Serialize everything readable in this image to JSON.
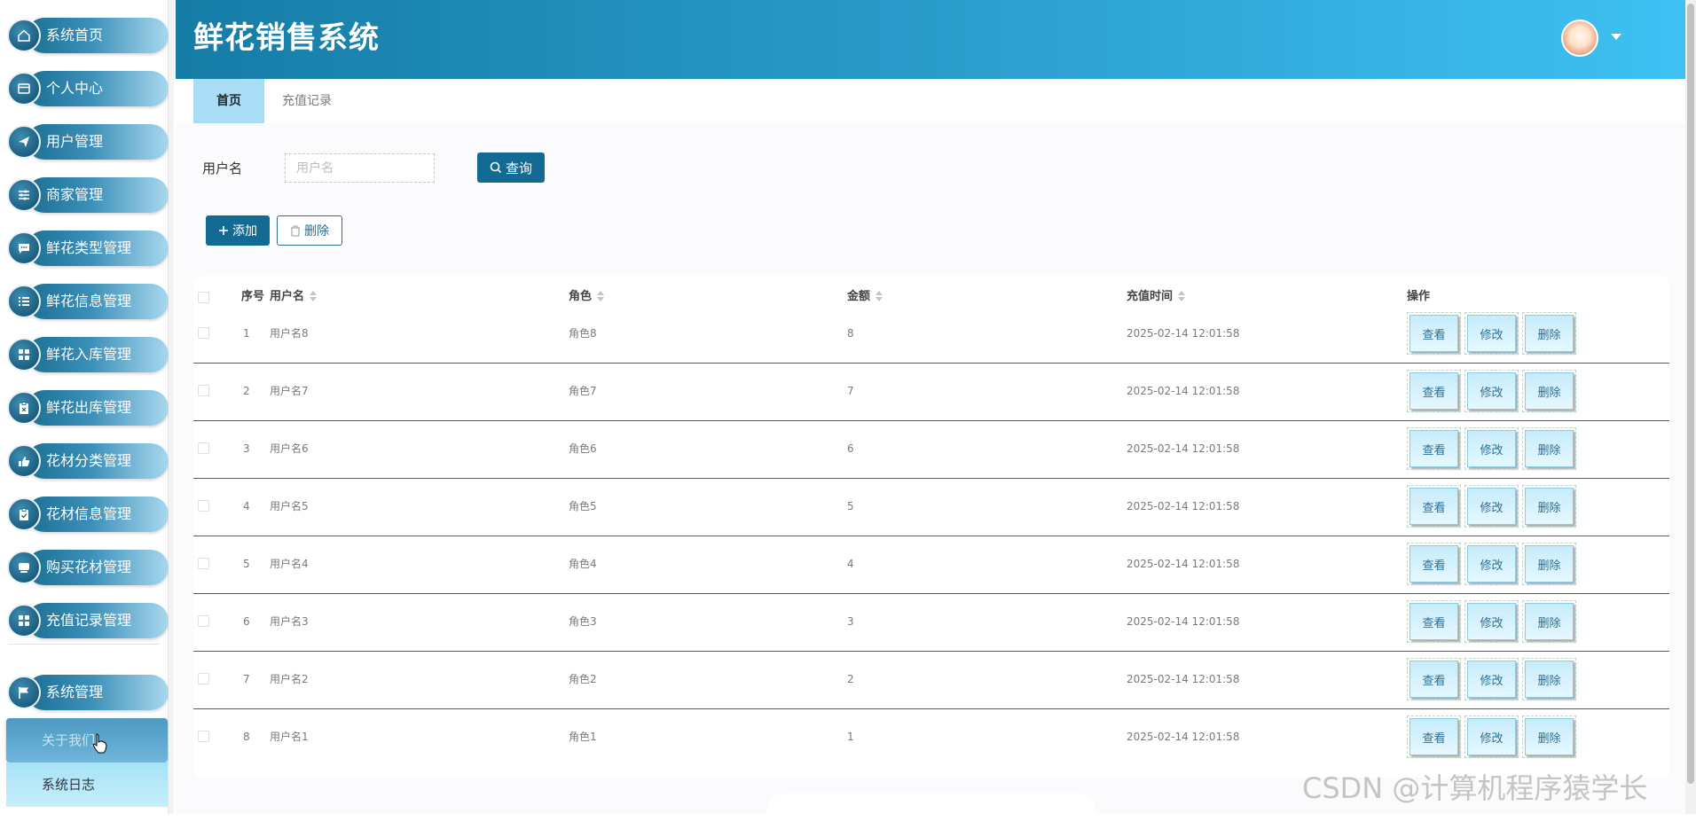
{
  "app": {
    "title": "鲜花销售系统"
  },
  "sidebar": {
    "items": [
      {
        "label": "系统首页",
        "icon": "home-icon"
      },
      {
        "label": "个人中心",
        "icon": "window-icon"
      },
      {
        "label": "用户管理",
        "icon": "send-icon"
      },
      {
        "label": "商家管理",
        "icon": "sliders-icon"
      },
      {
        "label": "鲜花类型管理",
        "icon": "chat-icon"
      },
      {
        "label": "鲜花信息管理",
        "icon": "list-icon"
      },
      {
        "label": "鲜花入库管理",
        "icon": "grid-icon"
      },
      {
        "label": "鲜花出库管理",
        "icon": "clipboard-icon"
      },
      {
        "label": "花材分类管理",
        "icon": "thumb-icon"
      },
      {
        "label": "花材信息管理",
        "icon": "clipboard-check-icon"
      },
      {
        "label": "购买花材管理",
        "icon": "monitor-icon"
      },
      {
        "label": "充值记录管理",
        "icon": "grid-icon"
      },
      {
        "label": "系统管理",
        "icon": "flag-icon"
      }
    ],
    "submenu": [
      {
        "label": "关于我们"
      },
      {
        "label": "系统日志"
      }
    ]
  },
  "tabs": [
    {
      "label": "首页",
      "active": true
    },
    {
      "label": "充值记录",
      "active": false
    }
  ],
  "search": {
    "label": "用户名",
    "placeholder": "用户名",
    "value": "",
    "query_label": "查询"
  },
  "actions": {
    "add_label": "添加",
    "delete_label": "删除"
  },
  "table": {
    "columns": [
      "序号",
      "用户名",
      "角色",
      "金额",
      "充值时间",
      "操作"
    ],
    "rows": [
      {
        "index": "1",
        "username": "用户名8",
        "role": "角色8",
        "amount": "8",
        "time": "2025-02-14 12:01:58"
      },
      {
        "index": "2",
        "username": "用户名7",
        "role": "角色7",
        "amount": "7",
        "time": "2025-02-14 12:01:58"
      },
      {
        "index": "3",
        "username": "用户名6",
        "role": "角色6",
        "amount": "6",
        "time": "2025-02-14 12:01:58"
      },
      {
        "index": "4",
        "username": "用户名5",
        "role": "角色5",
        "amount": "5",
        "time": "2025-02-14 12:01:58"
      },
      {
        "index": "5",
        "username": "用户名4",
        "role": "角色4",
        "amount": "4",
        "time": "2025-02-14 12:01:58"
      },
      {
        "index": "6",
        "username": "用户名3",
        "role": "角色3",
        "amount": "3",
        "time": "2025-02-14 12:01:58"
      },
      {
        "index": "7",
        "username": "用户名2",
        "role": "角色2",
        "amount": "2",
        "time": "2025-02-14 12:01:58"
      },
      {
        "index": "8",
        "username": "用户名1",
        "role": "角色1",
        "amount": "1",
        "time": "2025-02-14 12:01:58"
      }
    ],
    "row_actions": {
      "view": "查看",
      "edit": "修改",
      "delete": "删除"
    }
  },
  "watermark": "CSDN @计算机程序猿学长",
  "colors": {
    "primary": "#136b93",
    "header_start": "#157ca6",
    "header_end": "#3ec1f3",
    "active_tab": "#a9dcf5"
  }
}
